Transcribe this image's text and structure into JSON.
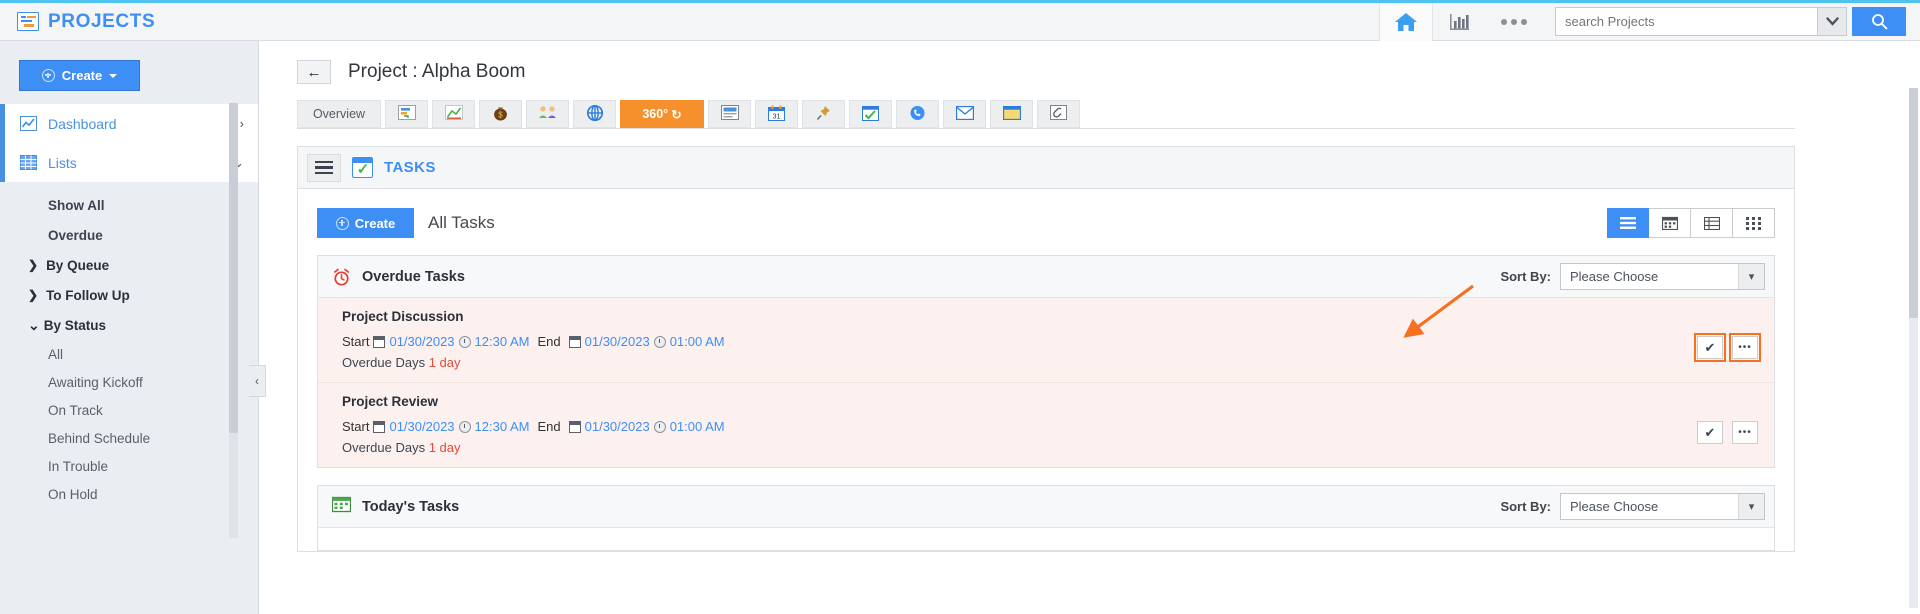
{
  "topbar": {
    "brand": "PROJECTS",
    "brand_icon": "projects-logo-icon",
    "home_icon": "home-icon",
    "reports_icon": "bar-chart-icon",
    "more_icon": "more-dots-icon",
    "search_placeholder": "search Projects",
    "search_value": "",
    "search_caret_icon": "chevron-down-icon",
    "search_button_icon": "search-icon"
  },
  "sidebar": {
    "create_label": "Create",
    "create_icon": "plus-circle-icon",
    "main_items": [
      {
        "label": "Dashboard",
        "icon": "line-chart-icon",
        "chevron": "›"
      },
      {
        "label": "Lists",
        "icon": "grid-table-icon",
        "chevron": "⌄"
      }
    ],
    "sub_items": [
      {
        "label": "Show All"
      },
      {
        "label": "Overdue"
      }
    ],
    "groups": [
      {
        "label": "By Queue",
        "chevron": "❯",
        "expanded": false
      },
      {
        "label": "To Follow Up",
        "chevron": "❯",
        "expanded": false
      },
      {
        "label": "By Status",
        "chevron": "⌄",
        "expanded": true
      }
    ],
    "status_items": [
      {
        "label": "All"
      },
      {
        "label": "Awaiting Kickoff"
      },
      {
        "label": "On Track"
      },
      {
        "label": "Behind Schedule"
      },
      {
        "label": "In Trouble"
      },
      {
        "label": "On Hold"
      }
    ],
    "collapse_icon": "chevron-left-icon"
  },
  "project": {
    "back_icon": "back-arrow-icon",
    "title": "Project : Alpha Boom"
  },
  "tabs": [
    {
      "label": "Overview",
      "icon": "",
      "type": "text",
      "active": false
    },
    {
      "label": "",
      "icon": "📋",
      "type": "icon",
      "name": "gantt-icon",
      "active": false
    },
    {
      "label": "",
      "icon": "📉",
      "type": "icon",
      "name": "milestone-icon",
      "active": false
    },
    {
      "label": "",
      "icon": "💰",
      "type": "icon",
      "name": "money-bag-icon",
      "active": false
    },
    {
      "label": "",
      "icon": "👥",
      "type": "icon",
      "name": "team-icon",
      "active": false
    },
    {
      "label": "",
      "icon": "⊕",
      "type": "icon",
      "name": "globe-icon",
      "active": false
    },
    {
      "label": "360°",
      "icon": "",
      "type": "text",
      "name": "360-view-tab",
      "active": true
    },
    {
      "label": "",
      "icon": "📄",
      "type": "icon",
      "name": "document-icon",
      "active": false
    },
    {
      "label": "",
      "icon": "📅",
      "type": "icon",
      "name": "calendar-icon",
      "active": false
    },
    {
      "label": "",
      "icon": "📌",
      "type": "icon",
      "name": "pin-icon",
      "active": false
    },
    {
      "label": "",
      "icon": "☑",
      "type": "icon",
      "name": "tasks-icon",
      "active": false
    },
    {
      "label": "",
      "icon": "📞",
      "type": "icon",
      "name": "phone-icon",
      "active": false
    },
    {
      "label": "",
      "icon": "✉",
      "type": "icon",
      "name": "mail-icon",
      "active": false
    },
    {
      "label": "",
      "icon": "🗒",
      "type": "icon",
      "name": "note-icon",
      "active": false
    },
    {
      "label": "",
      "icon": "🖇",
      "type": "icon",
      "name": "attachment-icon",
      "active": false
    }
  ],
  "tasks_panel": {
    "menu_icon": "hamburger-menu-icon",
    "title_icon": "tasks-calendar-check-icon",
    "title": "TASKS",
    "create_label": "Create",
    "create_icon": "plus-circle-icon",
    "heading": "All Tasks",
    "view_buttons": [
      {
        "name": "list-view-button",
        "icon": "☰",
        "active": true
      },
      {
        "name": "calendar-view-button",
        "icon": "🗓",
        "active": false
      },
      {
        "name": "table-view-button",
        "icon": "☷",
        "active": false
      },
      {
        "name": "grid-view-button",
        "icon": "⋮⋮⋮",
        "active": false
      }
    ],
    "groups": [
      {
        "name": "overdue-tasks-group",
        "icon": "alarm-clock-icon",
        "title": "Overdue Tasks",
        "sort_label": "Sort By:",
        "sort_value": "Please Choose",
        "sort_caret": "▾",
        "tasks": [
          {
            "name": "Project Discussion",
            "start_label": "Start",
            "start_date": "01/30/2023",
            "start_time": "12:30 AM",
            "end_label": "End",
            "end_date": "01/30/2023",
            "end_time": "01:00 AM",
            "overdue_label": "Overdue Days",
            "overdue_value": "1 day",
            "complete_icon": "✔",
            "more_icon": "•••",
            "highlighted": true
          },
          {
            "name": "Project Review",
            "start_label": "Start",
            "start_date": "01/30/2023",
            "start_time": "12:30 AM",
            "end_label": "End",
            "end_date": "01/30/2023",
            "end_time": "01:00 AM",
            "overdue_label": "Overdue Days",
            "overdue_value": "1 day",
            "complete_icon": "✔",
            "more_icon": "•••",
            "highlighted": false
          }
        ]
      },
      {
        "name": "todays-tasks-group",
        "icon": "today-calendar-icon",
        "title": "Today's Tasks",
        "sort_label": "Sort By:",
        "sort_value": "Please Choose",
        "sort_caret": "▾",
        "tasks": []
      }
    ]
  },
  "colors": {
    "accent_blue": "#3d8ef5",
    "active_tab_orange": "#f5902d",
    "annotation_orange": "#f5701f",
    "overdue_red": "#e34b3a",
    "sidebar_bg": "#eaeef3"
  }
}
